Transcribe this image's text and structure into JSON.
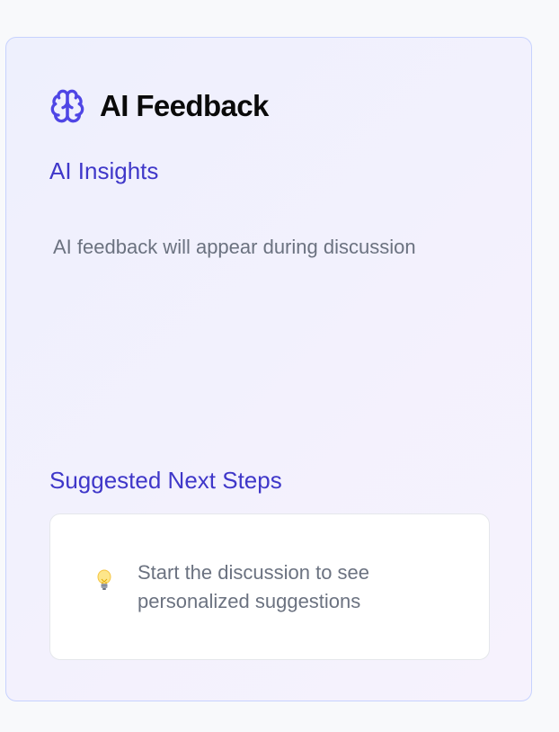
{
  "panel": {
    "title": "AI Feedback",
    "title_icon": "brain-icon",
    "accent_color": "#4f46e5"
  },
  "insights": {
    "heading": "AI Insights",
    "placeholder": "AI feedback will appear during discussion"
  },
  "next_steps": {
    "heading": "Suggested Next Steps",
    "icon": "lightbulb-icon",
    "empty_message": "Start the discussion to see personalized suggestions"
  }
}
